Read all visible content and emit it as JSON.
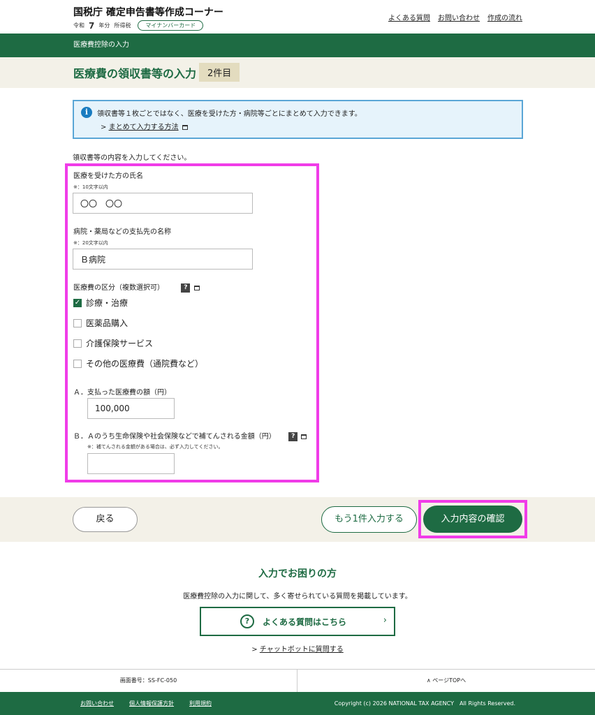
{
  "header": {
    "title": "国税庁 確定申告書等作成コーナー",
    "era": "令和",
    "year": "7",
    "year_suffix": "年分",
    "tax_type": "所得税",
    "mynumber_badge": "マイナンバーカード",
    "links": [
      "よくある質問",
      "お問い合わせ",
      "作成の流れ"
    ]
  },
  "breadcrumb": "医療費控除の入力",
  "page": {
    "title": "医療費の領収書等の入力",
    "count": "2件目"
  },
  "info": {
    "icon": "info-icon",
    "text": "領収書等１枚ごとではなく、医療を受けた方・病院等ごとにまとめて入力できます。",
    "link": "まとめて入力する方法"
  },
  "intro": "領収書等の内容を入力してください。",
  "form": {
    "patient_label": "医療を受けた方の氏名",
    "patient_note": "※：10文字以内",
    "patient_value": "〇〇　〇〇",
    "payee_label": "病院・薬局などの支払先の名称",
    "payee_note": "※：20文字以内",
    "payee_value": "Ｂ病院",
    "category_label": "医療費の区分（複数選択可）",
    "categories": [
      {
        "label": "診療・治療",
        "checked": true
      },
      {
        "label": "医薬品購入",
        "checked": false
      },
      {
        "label": "介護保険サービス",
        "checked": false
      },
      {
        "label": "その他の医療費（通院費など）",
        "checked": false
      }
    ],
    "amount_a_label": "Ａ．支払った医療費の額（円）",
    "amount_a_value": "100,000",
    "amount_b_label": "Ｂ．Ａのうち生命保険や社会保険などで補てんされる金額（円）",
    "amount_b_note": "※：補てんされる金額がある場合は、必ず入力してください。",
    "amount_b_value": ""
  },
  "actions": {
    "back": "戻る",
    "add_more": "もう1件入力する",
    "confirm": "入力内容の確認"
  },
  "help": {
    "title": "入力でお困りの方",
    "description": "医療費控除の入力に関して、多く寄せられている質問を掲載しています。",
    "faq_button": "よくある質問はこちら",
    "chatbot_link": "チャットボットに質問する"
  },
  "footer": {
    "screen_id": "画面番号：SS-FC-050",
    "page_top": "ページTOPへ",
    "links": [
      "お問い合わせ",
      "個人情報保護方針",
      "利用規約"
    ],
    "copyright": "Copyright (c) 2026 NATIONAL TAX AGENCY　All Rights Reserved."
  },
  "colors": {
    "brand_green": "#1e6b43",
    "highlight_magenta": "#f03ce8",
    "info_blue": "#1a7cc0"
  }
}
